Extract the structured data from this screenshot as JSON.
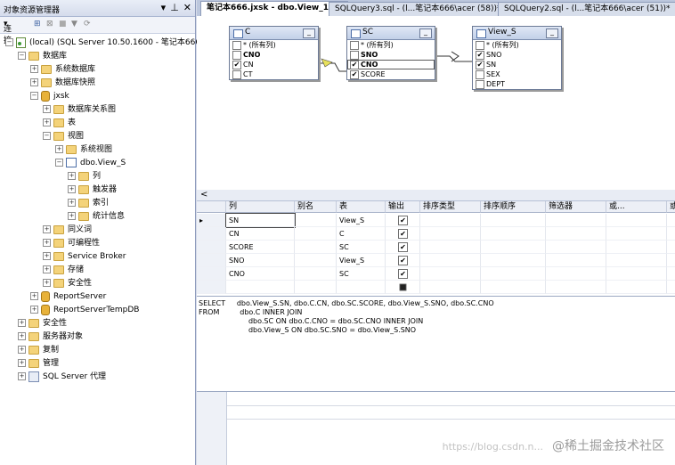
{
  "explorer": {
    "title": "对象资源管理器",
    "pin": "↓ ⊥ ✕",
    "connect_label": "连接",
    "tree": [
      {
        "label": "(local) (SQL Server 10.50.1600 - 笔记本666\\",
        "level": 0,
        "icon": "server-icon",
        "exp": "−"
      },
      {
        "label": "数据库",
        "level": 1,
        "icon": "folder-icon",
        "exp": "−"
      },
      {
        "label": "系统数据库",
        "level": 2,
        "icon": "folder-icon",
        "exp": "+"
      },
      {
        "label": "数据库快照",
        "level": 2,
        "icon": "folder-icon",
        "exp": "+"
      },
      {
        "label": "jxsk",
        "level": 2,
        "icon": "database-icon",
        "exp": "−"
      },
      {
        "label": "数据库关系图",
        "level": 3,
        "icon": "folder-icon",
        "exp": "+"
      },
      {
        "label": "表",
        "level": 3,
        "icon": "folder-icon",
        "exp": "+"
      },
      {
        "label": "视图",
        "level": 3,
        "icon": "folder-icon",
        "exp": "−"
      },
      {
        "label": "系统视图",
        "level": 4,
        "icon": "folder-icon",
        "exp": "+"
      },
      {
        "label": "dbo.View_S",
        "level": 4,
        "icon": "view-icon",
        "exp": "−"
      },
      {
        "label": "列",
        "level": 5,
        "icon": "folder-icon",
        "exp": "+"
      },
      {
        "label": "触发器",
        "level": 5,
        "icon": "folder-icon",
        "exp": "+"
      },
      {
        "label": "索引",
        "level": 5,
        "icon": "folder-icon",
        "exp": "+"
      },
      {
        "label": "统计信息",
        "level": 5,
        "icon": "folder-icon",
        "exp": "+"
      },
      {
        "label": "同义词",
        "level": 3,
        "icon": "folder-icon",
        "exp": "+"
      },
      {
        "label": "可编程性",
        "level": 3,
        "icon": "folder-icon",
        "exp": "+"
      },
      {
        "label": "Service Broker",
        "level": 3,
        "icon": "folder-icon",
        "exp": "+"
      },
      {
        "label": "存储",
        "level": 3,
        "icon": "folder-icon",
        "exp": "+"
      },
      {
        "label": "安全性",
        "level": 3,
        "icon": "folder-icon",
        "exp": "+"
      },
      {
        "label": "ReportServer",
        "level": 2,
        "icon": "database-icon",
        "exp": "+"
      },
      {
        "label": "ReportServerTempDB",
        "level": 2,
        "icon": "database-icon",
        "exp": "+"
      },
      {
        "label": "安全性",
        "level": 1,
        "icon": "folder-icon",
        "exp": "+"
      },
      {
        "label": "服务器对象",
        "level": 1,
        "icon": "folder-icon",
        "exp": "+"
      },
      {
        "label": "复制",
        "level": 1,
        "icon": "folder-icon",
        "exp": "+"
      },
      {
        "label": "管理",
        "level": 1,
        "icon": "folder-icon",
        "exp": "+"
      },
      {
        "label": "SQL Server 代理",
        "level": 1,
        "icon": "agent-icon",
        "exp": "+"
      }
    ]
  },
  "tabs": [
    {
      "label": "笔记本666.jxsk - dbo.View_1*",
      "close": "✕"
    },
    {
      "label": "SQLQuery3.sql - (l...笔记本666\\acer (58))*"
    },
    {
      "label": "SQLQuery2.sql - (l...笔记本666\\acer (51))*"
    }
  ],
  "diagram": {
    "tables": [
      {
        "name": "C",
        "columns": [
          {
            "name": "* (所有列)",
            "checked": false,
            "bold": false
          },
          {
            "name": "CNO",
            "checked": false,
            "bold": true
          },
          {
            "name": "CN",
            "checked": true,
            "bold": false
          },
          {
            "name": "CT",
            "checked": false,
            "bold": false
          }
        ]
      },
      {
        "name": "SC",
        "columns": [
          {
            "name": "* (所有列)",
            "checked": false,
            "bold": false
          },
          {
            "name": "SNO",
            "checked": false,
            "bold": true
          },
          {
            "name": "CNO",
            "checked": true,
            "bold": true
          },
          {
            "name": "SCORE",
            "checked": true,
            "bold": false
          }
        ]
      },
      {
        "name": "View_S",
        "columns": [
          {
            "name": "* (所有列)",
            "checked": false,
            "bold": false
          },
          {
            "name": "SNO",
            "checked": true,
            "bold": false
          },
          {
            "name": "SN",
            "checked": true,
            "bold": false
          },
          {
            "name": "SEX",
            "checked": false,
            "bold": false
          },
          {
            "name": "DEPT",
            "checked": false,
            "bold": false
          }
        ]
      }
    ]
  },
  "grid": {
    "headers": [
      "列",
      "别名",
      "表",
      "输出",
      "排序类型",
      "排序顺序",
      "筛选器",
      "或...",
      "或"
    ],
    "rows": [
      {
        "col": "SN",
        "alias": "",
        "table": "View_S",
        "output": true
      },
      {
        "col": "CN",
        "alias": "",
        "table": "C",
        "output": true
      },
      {
        "col": "SCORE",
        "alias": "",
        "table": "SC",
        "output": true
      },
      {
        "col": "SNO",
        "alias": "",
        "table": "View_S",
        "output": true
      },
      {
        "col": "CNO",
        "alias": "",
        "table": "SC",
        "output": true
      }
    ]
  },
  "sql": {
    "lines": [
      "SELECT     dbo.View_S.SN, dbo.C.CN, dbo.SC.SCORE, dbo.View_S.SNO, dbo.SC.CNO",
      "FROM         dbo.C INNER JOIN",
      "                      dbo.SC ON dbo.C.CNO = dbo.SC.CNO INNER JOIN",
      "                      dbo.View_S ON dbo.SC.SNO = dbo.View_S.SNO"
    ]
  },
  "watermark": {
    "url": "https://blog.csdn.n...",
    "brand": "@稀土掘金技术社区"
  }
}
